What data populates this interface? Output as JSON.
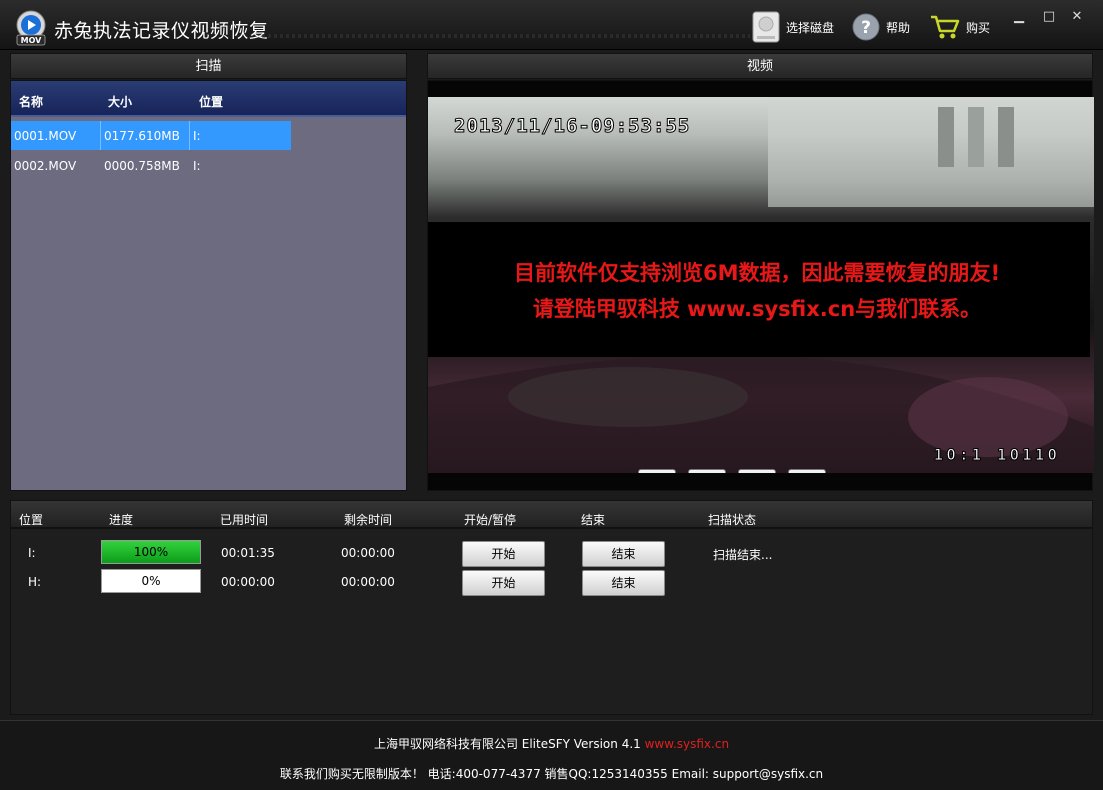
{
  "app": {
    "title": "赤兔执法记录仪视频恢复",
    "icon_label": "MOV"
  },
  "toolbar": {
    "select_disk": "选择磁盘",
    "help": "帮助",
    "buy": "购买"
  },
  "scan": {
    "header": "扫描",
    "columns": [
      "名称",
      "大小",
      "位置"
    ],
    "rows": [
      {
        "name": "0001.MOV",
        "size": "0177.610MB",
        "location": "I:"
      },
      {
        "name": "0002.MOV",
        "size": "0000.758MB",
        "location": "I:"
      }
    ]
  },
  "video": {
    "header": "视频",
    "timestamp_top": "2013/11/16-09:53:55",
    "timestamp_bottom": "10:1 10110",
    "notice_line1": "目前软件仅支持浏览6M数据，因此需要恢复的朋友!",
    "notice_line2": "请登陆甲驭科技 www.sysfix.cn与我们联系。"
  },
  "progress": {
    "columns": [
      "位置",
      "进度",
      "已用时间",
      "剩余时间",
      "开始/暂停",
      "结束",
      "扫描状态"
    ],
    "rows": [
      {
        "location": "I:",
        "progress": 100,
        "progress_label": "100%",
        "elapsed": "00:01:35",
        "remaining": "00:00:00",
        "start": "开始",
        "end": "结束",
        "status": "扫描结束..."
      },
      {
        "location": "H:",
        "progress": 0,
        "progress_label": "0%",
        "elapsed": "00:00:00",
        "remaining": "00:00:00",
        "start": "开始",
        "end": "结束",
        "status": ""
      }
    ]
  },
  "footer": {
    "company": "上海甲驭网络科技有限公司 EliteSFY Version 4.1",
    "website": "www.sysfix.cn",
    "contact": "联系我们购买无限制版本！ 电话:400-077-4377 销售QQ:1253140355 Email: support@sysfix.cn"
  },
  "colors": {
    "accent": "#3399ff",
    "notice": "#e81818",
    "progress_fill": "#1fbf2d"
  }
}
